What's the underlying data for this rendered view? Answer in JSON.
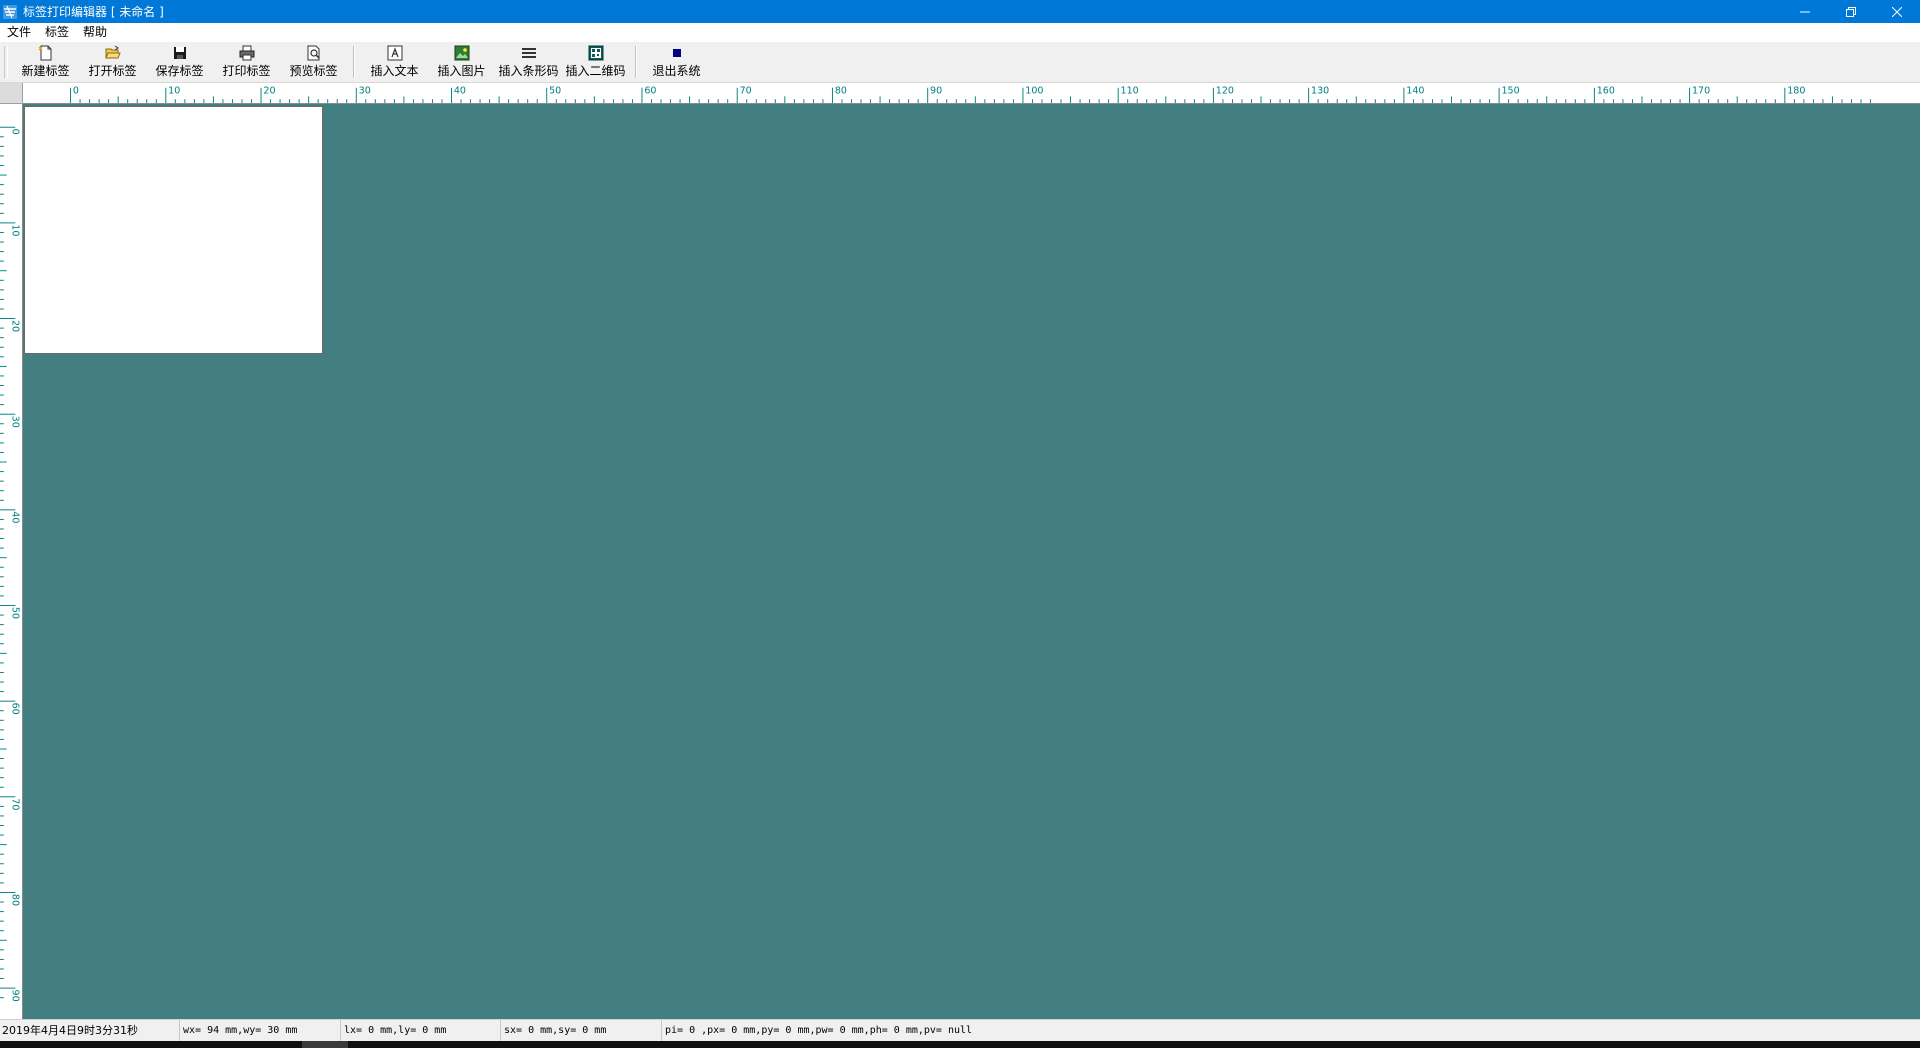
{
  "window": {
    "title": "标签打印编辑器 [ 未命名 ]",
    "controls": [
      "minimize",
      "restore",
      "close"
    ]
  },
  "menu": {
    "items": [
      "文件",
      "标签",
      "帮助"
    ]
  },
  "toolbar": {
    "buttons": [
      {
        "label": "新建标签",
        "icon": "new-label-icon"
      },
      {
        "label": "打开标签",
        "icon": "open-folder-icon"
      },
      {
        "label": "保存标签",
        "icon": "save-disk-icon"
      },
      {
        "label": "打印标签",
        "icon": "printer-icon"
      },
      {
        "label": "预览标签",
        "icon": "preview-icon"
      },
      {
        "label": "插入文本",
        "icon": "insert-text-icon"
      },
      {
        "label": "插入图片",
        "icon": "insert-image-icon"
      },
      {
        "label": "插入条形码",
        "icon": "barcode-icon"
      },
      {
        "label": "插入二维码",
        "icon": "qrcode-icon"
      },
      {
        "label": "退出系统",
        "icon": "exit-icon"
      }
    ]
  },
  "rulers": {
    "horizontal_labels": [
      "0",
      "10",
      "20",
      "30",
      "40",
      "50",
      "60",
      "70",
      "80",
      "90",
      "100",
      "110",
      "120",
      "130",
      "140",
      "150",
      "160",
      "170",
      "180"
    ],
    "vertical_labels": [
      "0",
      "10",
      "20",
      "30",
      "40",
      "50",
      "60",
      "70",
      "80",
      "90"
    ],
    "color": "#008080"
  },
  "colors": {
    "titlebar": "#0078d7",
    "workspace": "#437f80",
    "canvas": "#ffffff"
  },
  "status": {
    "datetime": "2019年4月4日9时3分31秒",
    "window_size": "wx= 94 mm,wy= 30 mm",
    "label_pos": "lx= 0 mm,ly= 0 mm",
    "selection": "sx= 0 mm,sy= 0 mm",
    "item_info": "pi= 0 ,px= 0 mm,py= 0 mm,pw= 0 mm,ph= 0 mm,pv= null"
  }
}
